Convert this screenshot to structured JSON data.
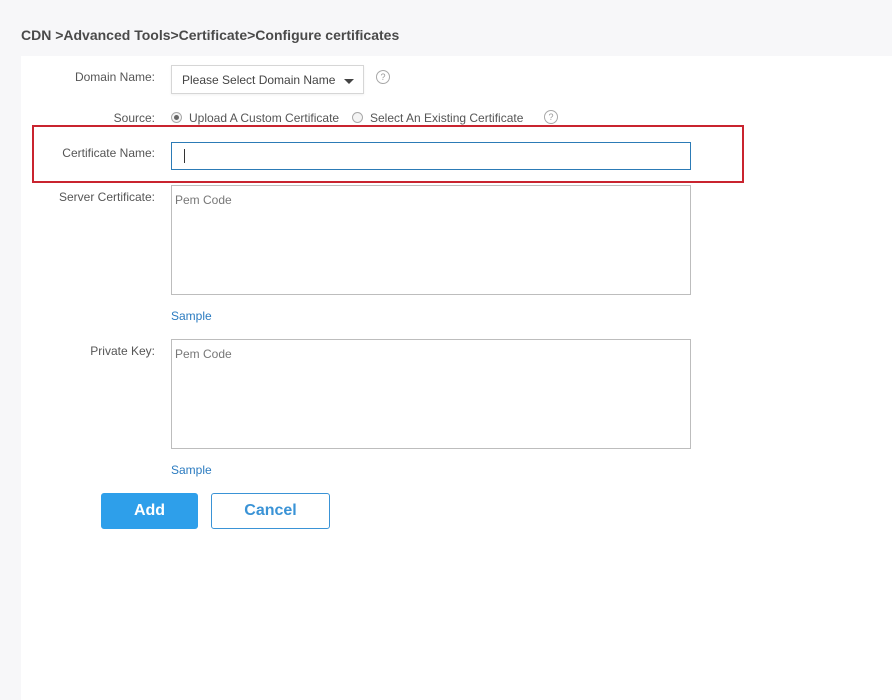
{
  "breadcrumb": "CDN >Advanced Tools>Certificate>Configure certificates",
  "form": {
    "domain_name_label": "Domain Name:",
    "domain_select_value": "Please Select Domain Name",
    "source_label": "Source:",
    "source_options": [
      "Upload A Custom Certificate",
      "Select An Existing Certificate"
    ],
    "source_selected": "Upload A Custom Certificate",
    "certificate_name_label": "Certificate Name:",
    "certificate_name_value": "",
    "server_certificate_label": "Server Certificate:",
    "server_certificate_placeholder": "Pem Code",
    "private_key_label": "Private Key:",
    "private_key_placeholder": "Pem Code",
    "sample_link": "Sample",
    "help_glyph": "?"
  },
  "buttons": {
    "add": "Add",
    "cancel": "Cancel"
  },
  "colors": {
    "primary": "#2e9fea",
    "link": "#2b7bc0",
    "highlight": "#c9242f",
    "focus_border": "#2c7bb6"
  }
}
